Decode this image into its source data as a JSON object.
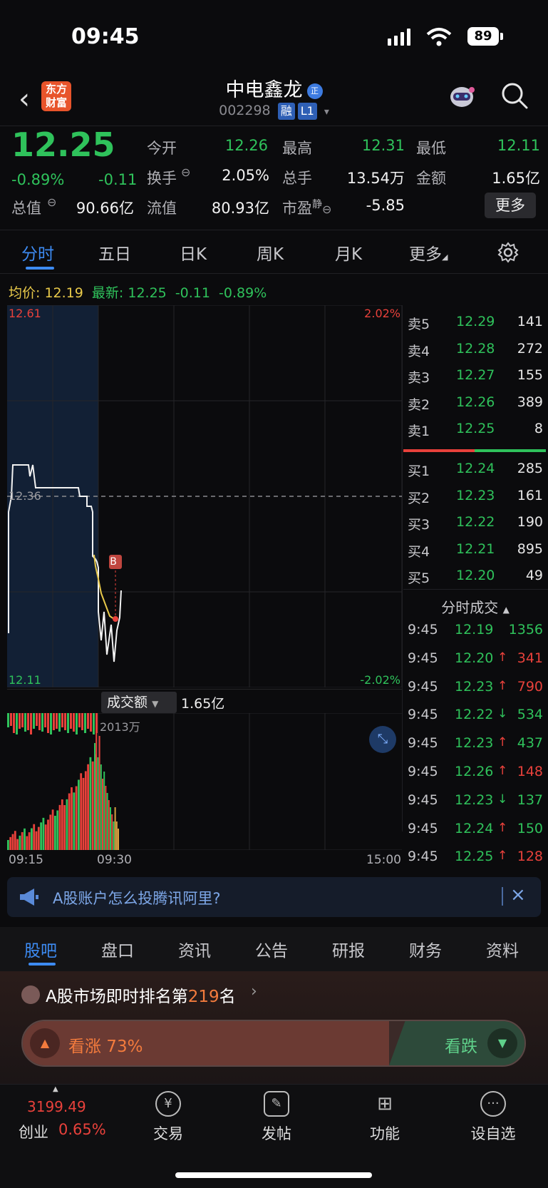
{
  "status_bar": {
    "time": "09:45",
    "battery": "89"
  },
  "header": {
    "back_icon": "chevron-left-icon",
    "logo_text": "东方\n财富",
    "stock_name": "中电鑫龙",
    "badge": "正",
    "code": "002298",
    "tag_margin": "融",
    "tag_level": "L1"
  },
  "quote": {
    "price": "12.25",
    "change_pct": "-0.89%",
    "change": "-0.11",
    "open_label": "今开",
    "open": "12.26",
    "high_label": "最高",
    "high": "12.31",
    "low_label": "最低",
    "low": "12.11",
    "turnover_label": "换手",
    "turnover": "2.05%",
    "volume_label": "总手",
    "volume": "13.54万",
    "amount_label": "金额",
    "amount": "1.65亿",
    "mcap_label": "总值",
    "mcap": "90.66亿",
    "float_label": "流值",
    "float": "80.93亿",
    "pe_label": "市盈",
    "pe_sup": "静",
    "pe": "-5.85",
    "more": "更多"
  },
  "chart_tabs": [
    "分时",
    "五日",
    "日K",
    "周K",
    "月K",
    "更多"
  ],
  "avg_line": {
    "avg_label": "均价:",
    "avg": "12.19",
    "latest_label": "最新:",
    "latest": "12.25",
    "chg": "-0.11",
    "pct": "-0.89%"
  },
  "chart_axis": {
    "top_price": "12.61",
    "mid_price": "12.36",
    "bottom_price": "12.11",
    "top_pct": "2.02%",
    "bottom_pct": "-2.02%",
    "marker": "B"
  },
  "order_book": {
    "asks": [
      {
        "label": "卖5",
        "price": "12.29",
        "vol": "141"
      },
      {
        "label": "卖4",
        "price": "12.28",
        "vol": "272"
      },
      {
        "label": "卖3",
        "price": "12.27",
        "vol": "155"
      },
      {
        "label": "卖2",
        "price": "12.26",
        "vol": "389"
      },
      {
        "label": "卖1",
        "price": "12.25",
        "vol": "8"
      }
    ],
    "bids": [
      {
        "label": "买1",
        "price": "12.24",
        "vol": "285"
      },
      {
        "label": "买2",
        "price": "12.23",
        "vol": "161"
      },
      {
        "label": "买3",
        "price": "12.22",
        "vol": "190"
      },
      {
        "label": "买4",
        "price": "12.21",
        "vol": "895"
      },
      {
        "label": "买5",
        "price": "12.20",
        "vol": "49"
      }
    ]
  },
  "trades": {
    "title": "分时成交",
    "rows": [
      {
        "t": "9:45",
        "p": "12.19",
        "a": "",
        "v": "1356",
        "dir": "down"
      },
      {
        "t": "9:45",
        "p": "12.20",
        "a": "↑",
        "v": "341",
        "dir": "up"
      },
      {
        "t": "9:45",
        "p": "12.23",
        "a": "↑",
        "v": "790",
        "dir": "up"
      },
      {
        "t": "9:45",
        "p": "12.22",
        "a": "↓",
        "v": "534",
        "dir": "down"
      },
      {
        "t": "9:45",
        "p": "12.23",
        "a": "↑",
        "v": "437",
        "dir": "down"
      },
      {
        "t": "9:45",
        "p": "12.26",
        "a": "↑",
        "v": "148",
        "dir": "up"
      },
      {
        "t": "9:45",
        "p": "12.23",
        "a": "↓",
        "v": "137",
        "dir": "down"
      },
      {
        "t": "9:45",
        "p": "12.24",
        "a": "↑",
        "v": "150",
        "dir": "down"
      },
      {
        "t": "9:45",
        "p": "12.25",
        "a": "↑",
        "v": "128",
        "dir": "up"
      }
    ]
  },
  "volume": {
    "selector": "成交额",
    "amount": "1.65亿",
    "peak": "2013万"
  },
  "x_axis": [
    "09:15",
    "09:30",
    "15:00"
  ],
  "news": {
    "text": "A股账户怎么投腾讯阿里?"
  },
  "bottom_tabs": [
    "股吧",
    "盘口",
    "资讯",
    "公告",
    "研报",
    "财务",
    "资料"
  ],
  "rank": {
    "prefix": "A股市场即时排名第",
    "num": "219",
    "suffix": "名"
  },
  "sentiment": {
    "bull_label": "看涨 73%",
    "bull_pct": 73,
    "bear_label": "看跌"
  },
  "bottom_nav": {
    "index_val": "3199.49",
    "index_name": "创业",
    "index_chg": "0.65%",
    "items": [
      "交易",
      "发帖",
      "功能",
      "设自选"
    ]
  },
  "colors": {
    "up": "#e8413b",
    "down": "#2fc25b",
    "accent": "#3d8bf2",
    "avg_line": "#e8c94a"
  }
}
